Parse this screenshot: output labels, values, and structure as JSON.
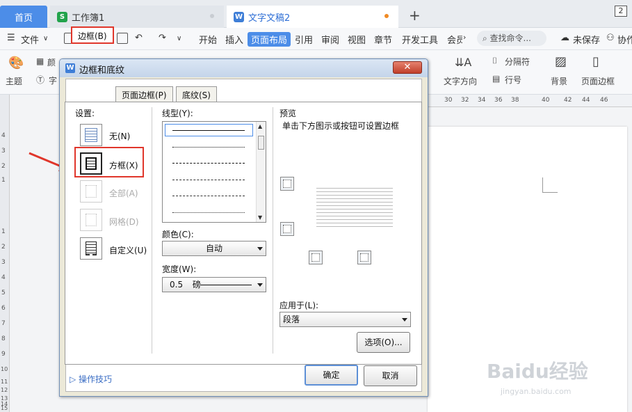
{
  "tabs": {
    "home": "首页",
    "sheet": "工作簿1",
    "doc": "文字文稿2",
    "window_count": "2"
  },
  "menu": {
    "file": "文件",
    "items": [
      "开始",
      "插入",
      "页面布局",
      "引用",
      "审阅",
      "视图",
      "章节",
      "开发工具",
      "会员"
    ],
    "search_placeholder": "查找命令...",
    "unsaved": "未保存",
    "collab": "协作"
  },
  "ribbon": {
    "theme": "主题",
    "font_partial": "字",
    "color_partial": "颜",
    "text_direction": "文字方向",
    "separator": "分隔符",
    "line_number": "行号",
    "background": "背景",
    "page_border": "页面边框"
  },
  "ruler": {
    "ticks": [
      "30",
      "32",
      "34",
      "36",
      "38",
      "40",
      "42",
      "44",
      "46"
    ],
    "vticks": [
      "4",
      "3",
      "2",
      "1",
      "1",
      "2",
      "3",
      "4",
      "5",
      "6",
      "7",
      "8",
      "9",
      "10",
      "11",
      "12",
      "13",
      "14",
      "15"
    ]
  },
  "dialog": {
    "title": "边框和底纹",
    "close": "✕",
    "tabs": {
      "border": "边框(B)",
      "page_border": "页面边框(P)",
      "shading": "底纹(S)"
    },
    "settings_label": "设置:",
    "settings": {
      "none": "无(N)",
      "box": "方框(X)",
      "all": "全部(A)",
      "grid": "网格(D)",
      "custom": "自定义(U)"
    },
    "line_style_label": "线型(Y):",
    "color_label": "颜色(C):",
    "color_value": "自动",
    "width_label": "宽度(W):",
    "width_value": "0.5",
    "width_unit": "磅",
    "preview_label": "预览",
    "preview_hint": "单击下方图示或按钮可设置边框",
    "apply_label": "应用于(L):",
    "apply_value": "段落",
    "options_button": "选项(O)...",
    "tips": "操作技巧",
    "ok": "确定",
    "cancel": "取消"
  },
  "watermark": {
    "brand": "Baidu经验",
    "url": "jingyan.baidu.com"
  },
  "colors": {
    "accent": "#4c8de8",
    "highlight": "#e0362b"
  }
}
